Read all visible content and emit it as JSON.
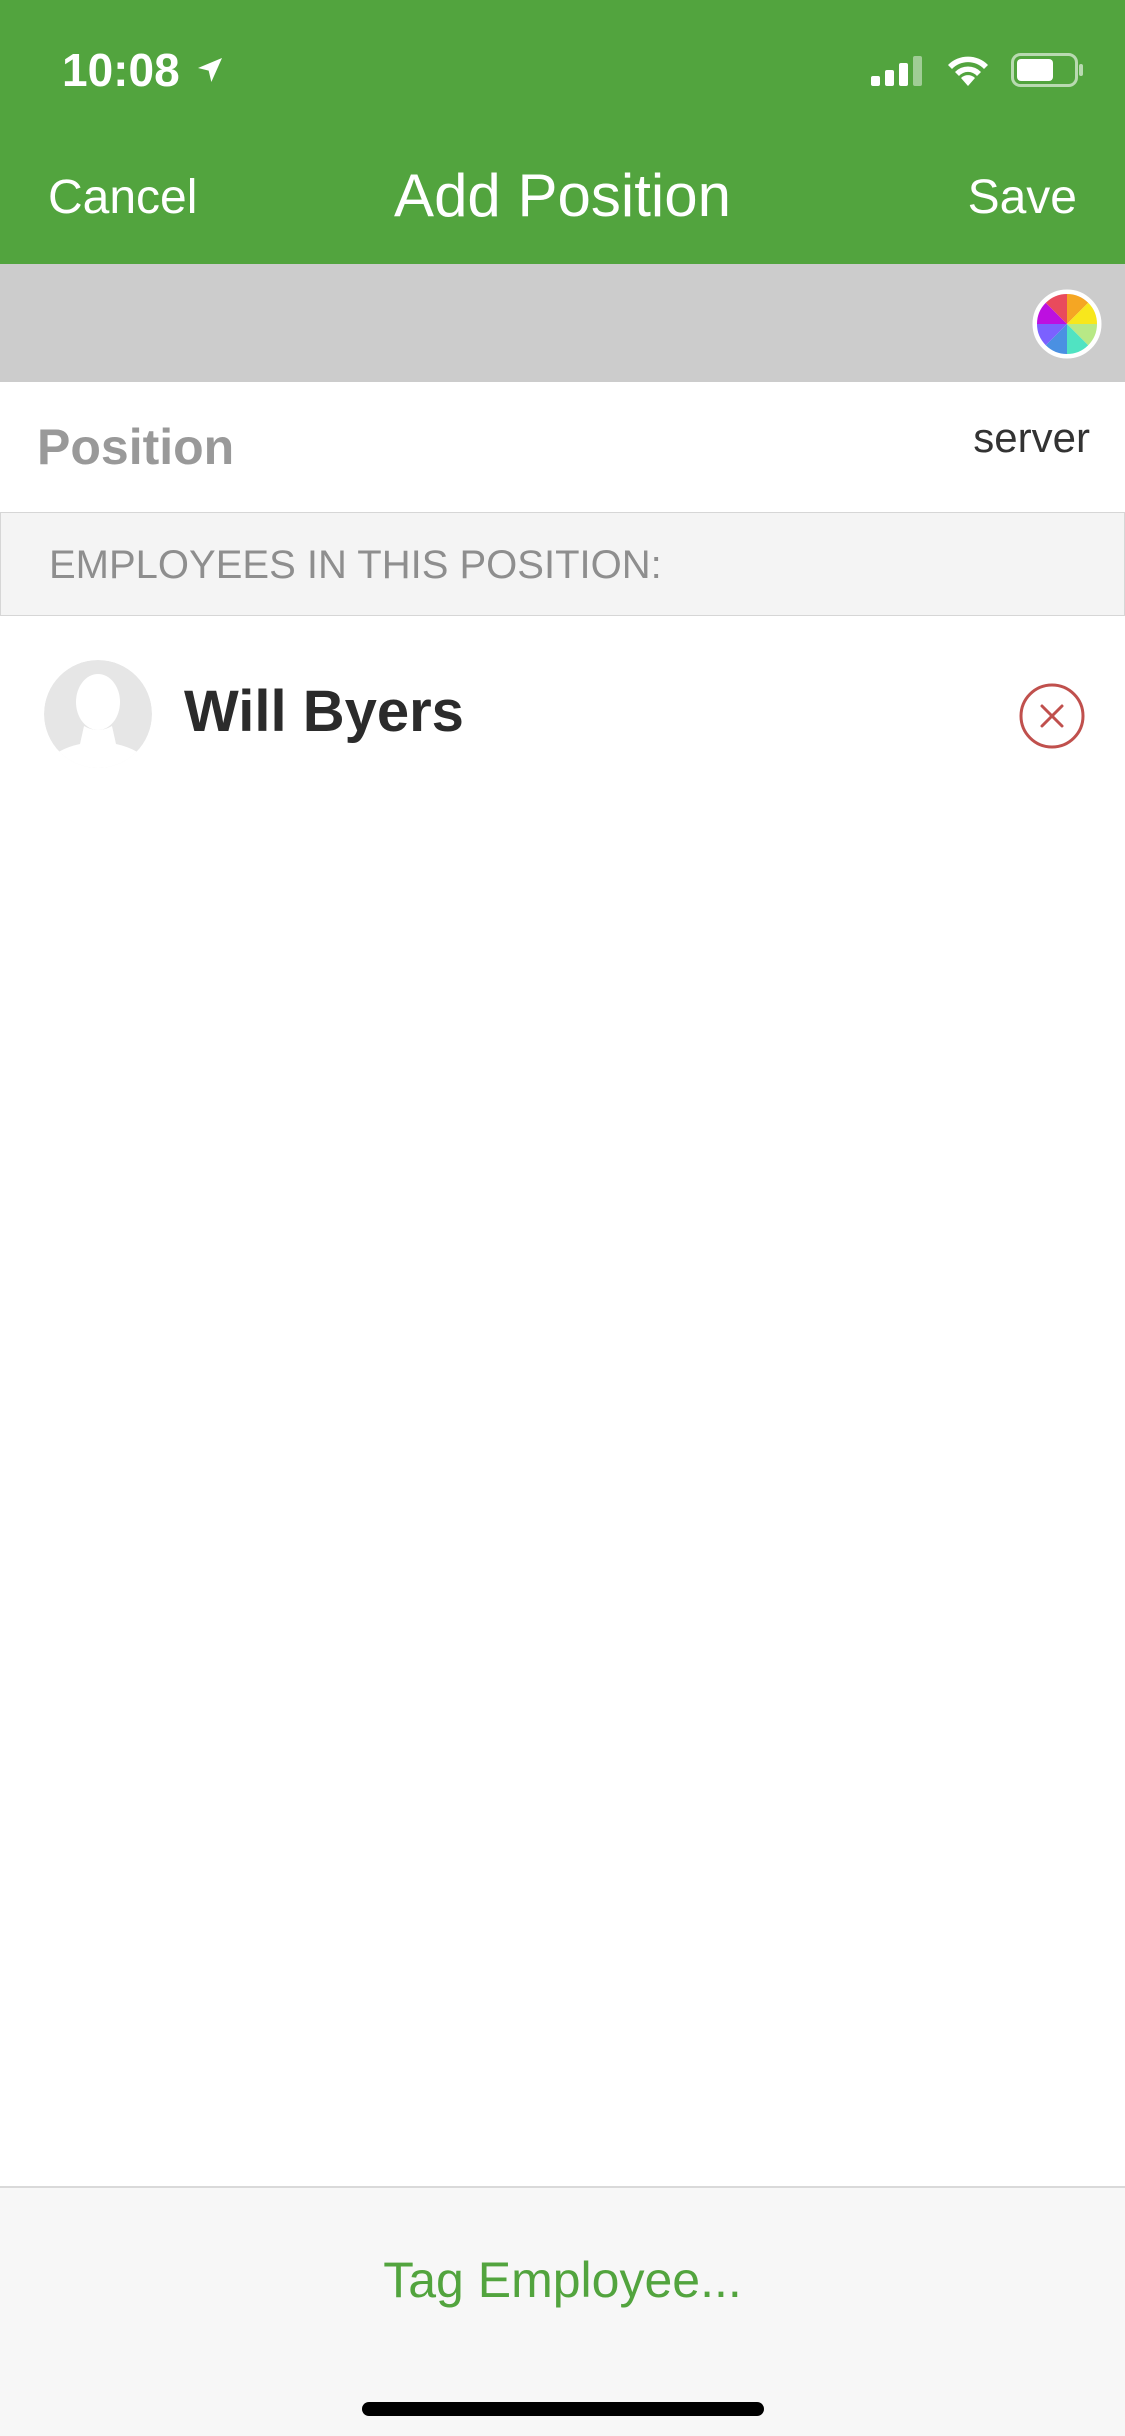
{
  "status_bar": {
    "time": "10:08",
    "location_icon": "location-arrow-icon",
    "signal_icon": "cellular-signal-icon",
    "wifi_icon": "wifi-icon",
    "battery_icon": "battery-icon"
  },
  "nav": {
    "cancel_label": "Cancel",
    "title": "Add Position",
    "save_label": "Save"
  },
  "color_picker": {
    "icon": "color-wheel-icon"
  },
  "position": {
    "label": "Position",
    "value": "server"
  },
  "employees_section": {
    "header": "EMPLOYEES IN THIS POSITION:",
    "items": [
      {
        "name": "Will Byers",
        "avatar_icon": "person-silhouette-icon",
        "remove_icon": "remove-circle-x-icon"
      }
    ]
  },
  "bottom": {
    "tag_label": "Tag Employee..."
  },
  "colors": {
    "brand_green": "#52a43e",
    "remove_red": "#c0504d",
    "strip_gray": "#cccccc"
  }
}
